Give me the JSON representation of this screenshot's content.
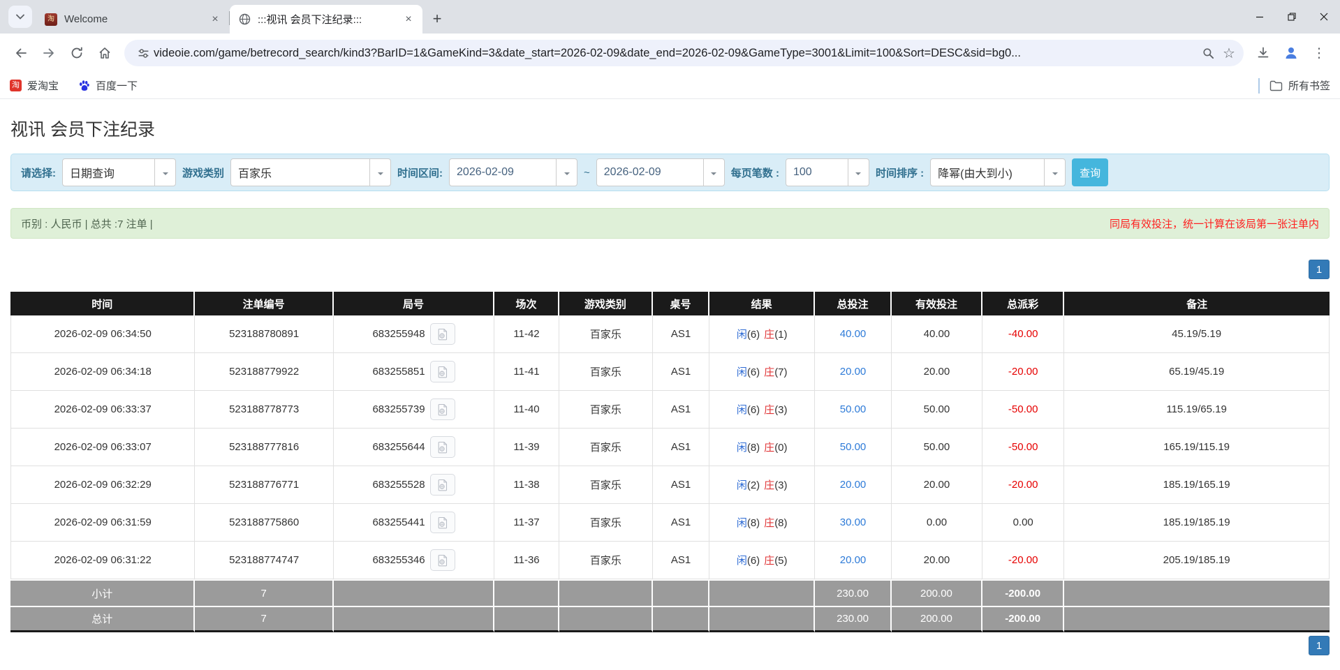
{
  "colors": {
    "accent": "#45b6dd",
    "pager": "#337ab7",
    "link": "#2e7bd8",
    "player": "#2e6bd4",
    "banker": "#e03537",
    "negative": "#e60000",
    "note": "#ff2020",
    "header-bg": "#1a1a1a",
    "footer-bg": "#9b9b9b",
    "info-bg": "#d9edf7",
    "info-border": "#b7dff0",
    "success-bg": "#dff0d8",
    "success-border": "#d0e6c4",
    "label": "#31708f"
  },
  "icons": {
    "star": "☆",
    "plus": "+",
    "close": "×",
    "kebab": "⋮",
    "tao": "淘"
  },
  "browser": {
    "tabs": [
      {
        "title": "Welcome"
      },
      {
        "title": ":::视讯 会员下注纪录:::"
      }
    ],
    "url": "videoie.com/game/betrecord_search/kind3?BarID=1&GameKind=3&date_start=2026-02-09&date_end=2026-02-09&GameType=3001&Limit=100&Sort=DESC&sid=bg0...",
    "bookmarks": {
      "item1": "爱淘宝",
      "item2": "百度一下",
      "all_label": "所有书签"
    }
  },
  "page": {
    "title": "视讯 会员下注纪录",
    "filters": {
      "select_label": "请选择:",
      "select_value": "日期查询",
      "game_kind_label": "游戏类别",
      "game_kind_value": "百家乐",
      "date_range_label": "时间区间:",
      "date_start": "2026-02-09",
      "tilde": "~",
      "date_end": "2026-02-09",
      "page_size_label": "每页笔数 :",
      "page_size_value": "100",
      "sort_label": "时间排序 :",
      "sort_value": "降幂(由大到小)",
      "search_button": "查询"
    },
    "summary": {
      "left": "币别 : 人民币 | 总共 :7 注单 |",
      "right": "同局有效投注，统一计算在该局第一张注单内"
    },
    "pagination": {
      "page": "1"
    },
    "table": {
      "headers": [
        "时间",
        "注单编号",
        "局号",
        "场次",
        "游戏类别",
        "桌号",
        "结果",
        "总投注",
        "有效投注",
        "总派彩",
        "备注"
      ],
      "rows": [
        {
          "time": "2026-02-09 06:34:50",
          "bet_id": "523188780891",
          "round": "683255948",
          "session": "11-42",
          "game": "百家乐",
          "table": "AS1",
          "result": {
            "p": "闲",
            "pn": "(6)",
            "b": "庄",
            "bn": "(1)"
          },
          "total_bet": "40.00",
          "valid_bet": "40.00",
          "payout": "-40.00",
          "remark": "45.19/5.19"
        },
        {
          "time": "2026-02-09 06:34:18",
          "bet_id": "523188779922",
          "round": "683255851",
          "session": "11-41",
          "game": "百家乐",
          "table": "AS1",
          "result": {
            "p": "闲",
            "pn": "(6)",
            "b": "庄",
            "bn": "(7)"
          },
          "total_bet": "20.00",
          "valid_bet": "20.00",
          "payout": "-20.00",
          "remark": "65.19/45.19"
        },
        {
          "time": "2026-02-09 06:33:37",
          "bet_id": "523188778773",
          "round": "683255739",
          "session": "11-40",
          "game": "百家乐",
          "table": "AS1",
          "result": {
            "p": "闲",
            "pn": "(6)",
            "b": "庄",
            "bn": "(3)"
          },
          "total_bet": "50.00",
          "valid_bet": "50.00",
          "payout": "-50.00",
          "remark": "115.19/65.19"
        },
        {
          "time": "2026-02-09 06:33:07",
          "bet_id": "523188777816",
          "round": "683255644",
          "session": "11-39",
          "game": "百家乐",
          "table": "AS1",
          "result": {
            "p": "闲",
            "pn": "(8)",
            "b": "庄",
            "bn": "(0)"
          },
          "total_bet": "50.00",
          "valid_bet": "50.00",
          "payout": "-50.00",
          "remark": "165.19/115.19"
        },
        {
          "time": "2026-02-09 06:32:29",
          "bet_id": "523188776771",
          "round": "683255528",
          "session": "11-38",
          "game": "百家乐",
          "table": "AS1",
          "result": {
            "p": "闲",
            "pn": "(2)",
            "b": "庄",
            "bn": "(3)"
          },
          "total_bet": "20.00",
          "valid_bet": "20.00",
          "payout": "-20.00",
          "remark": "185.19/165.19"
        },
        {
          "time": "2026-02-09 06:31:59",
          "bet_id": "523188775860",
          "round": "683255441",
          "session": "11-37",
          "game": "百家乐",
          "table": "AS1",
          "result": {
            "p": "闲",
            "pn": "(8)",
            "b": "庄",
            "bn": "(8)"
          },
          "total_bet": "30.00",
          "valid_bet": "0.00",
          "payout": "0.00",
          "remark": "185.19/185.19"
        },
        {
          "time": "2026-02-09 06:31:22",
          "bet_id": "523188774747",
          "round": "683255346",
          "session": "11-36",
          "game": "百家乐",
          "table": "AS1",
          "result": {
            "p": "闲",
            "pn": "(6)",
            "b": "庄",
            "bn": "(5)"
          },
          "total_bet": "20.00",
          "valid_bet": "20.00",
          "payout": "-20.00",
          "remark": "205.19/185.19"
        }
      ],
      "subtotal": {
        "label": "小计",
        "count": "7",
        "total_bet": "230.00",
        "valid_bet": "200.00",
        "payout": "-200.00"
      },
      "total": {
        "label": "总计",
        "count": "7",
        "total_bet": "230.00",
        "valid_bet": "200.00",
        "payout": "-200.00"
      }
    }
  }
}
